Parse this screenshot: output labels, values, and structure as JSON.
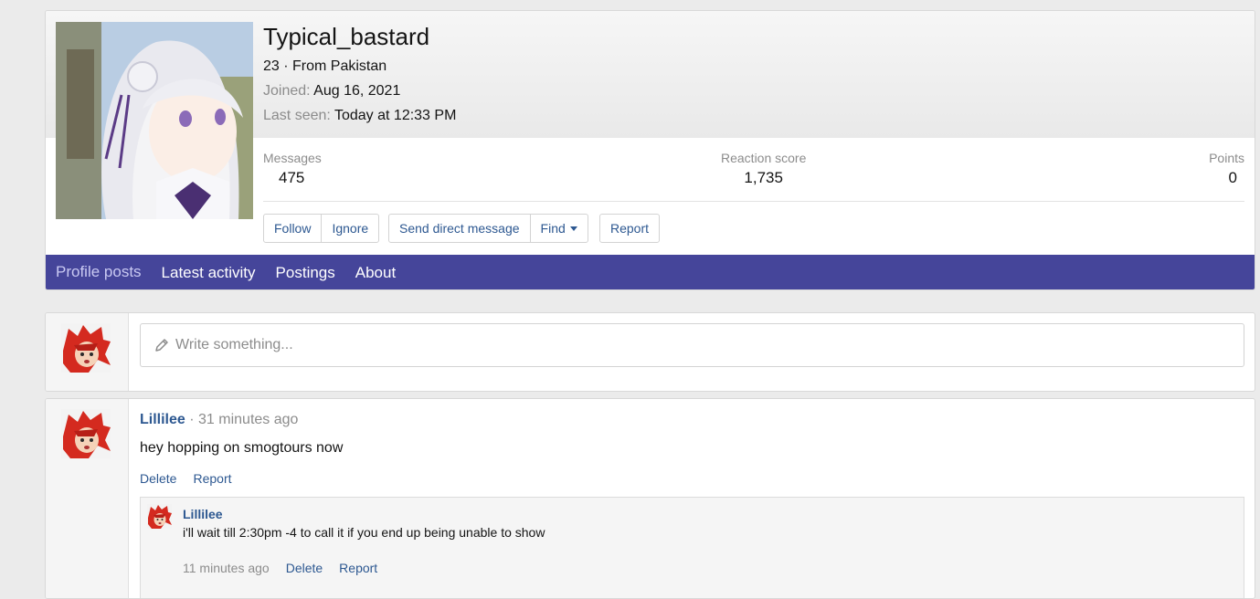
{
  "profile": {
    "username": "Typical_bastard",
    "age_location": "23 · From Pakistan",
    "joined_label": "Joined:",
    "joined_value": "Aug 16, 2021",
    "last_seen_label": "Last seen:",
    "last_seen_value": "Today at 12:33 PM",
    "avatar_icon": "anime-girl-avatar"
  },
  "stats": [
    {
      "label": "Messages",
      "value": "475"
    },
    {
      "label": "Reaction score",
      "value": "1,735"
    },
    {
      "label": "Points",
      "value": "0"
    }
  ],
  "actions": {
    "follow": "Follow",
    "ignore": "Ignore",
    "send_dm": "Send direct message",
    "find": "Find",
    "report": "Report"
  },
  "tabs": [
    "Profile posts",
    "Latest activity",
    "Postings",
    "About"
  ],
  "active_tab": "Profile posts",
  "write": {
    "placeholder": "Write something...",
    "icon": "pencil-icon"
  },
  "post": {
    "author": "Lillilee",
    "time": "· 31 minutes ago",
    "body": "hey hopping on smogtours now",
    "delete": "Delete",
    "report": "Report"
  },
  "comment": {
    "author": "Lillilee",
    "body": "i'll wait till 2:30pm -4 to call it if you end up being unable to show",
    "time": "11 minutes ago",
    "delete": "Delete",
    "report": "Report"
  },
  "colors": {
    "tab_bar": "#45459a",
    "link": "#2d5891"
  }
}
